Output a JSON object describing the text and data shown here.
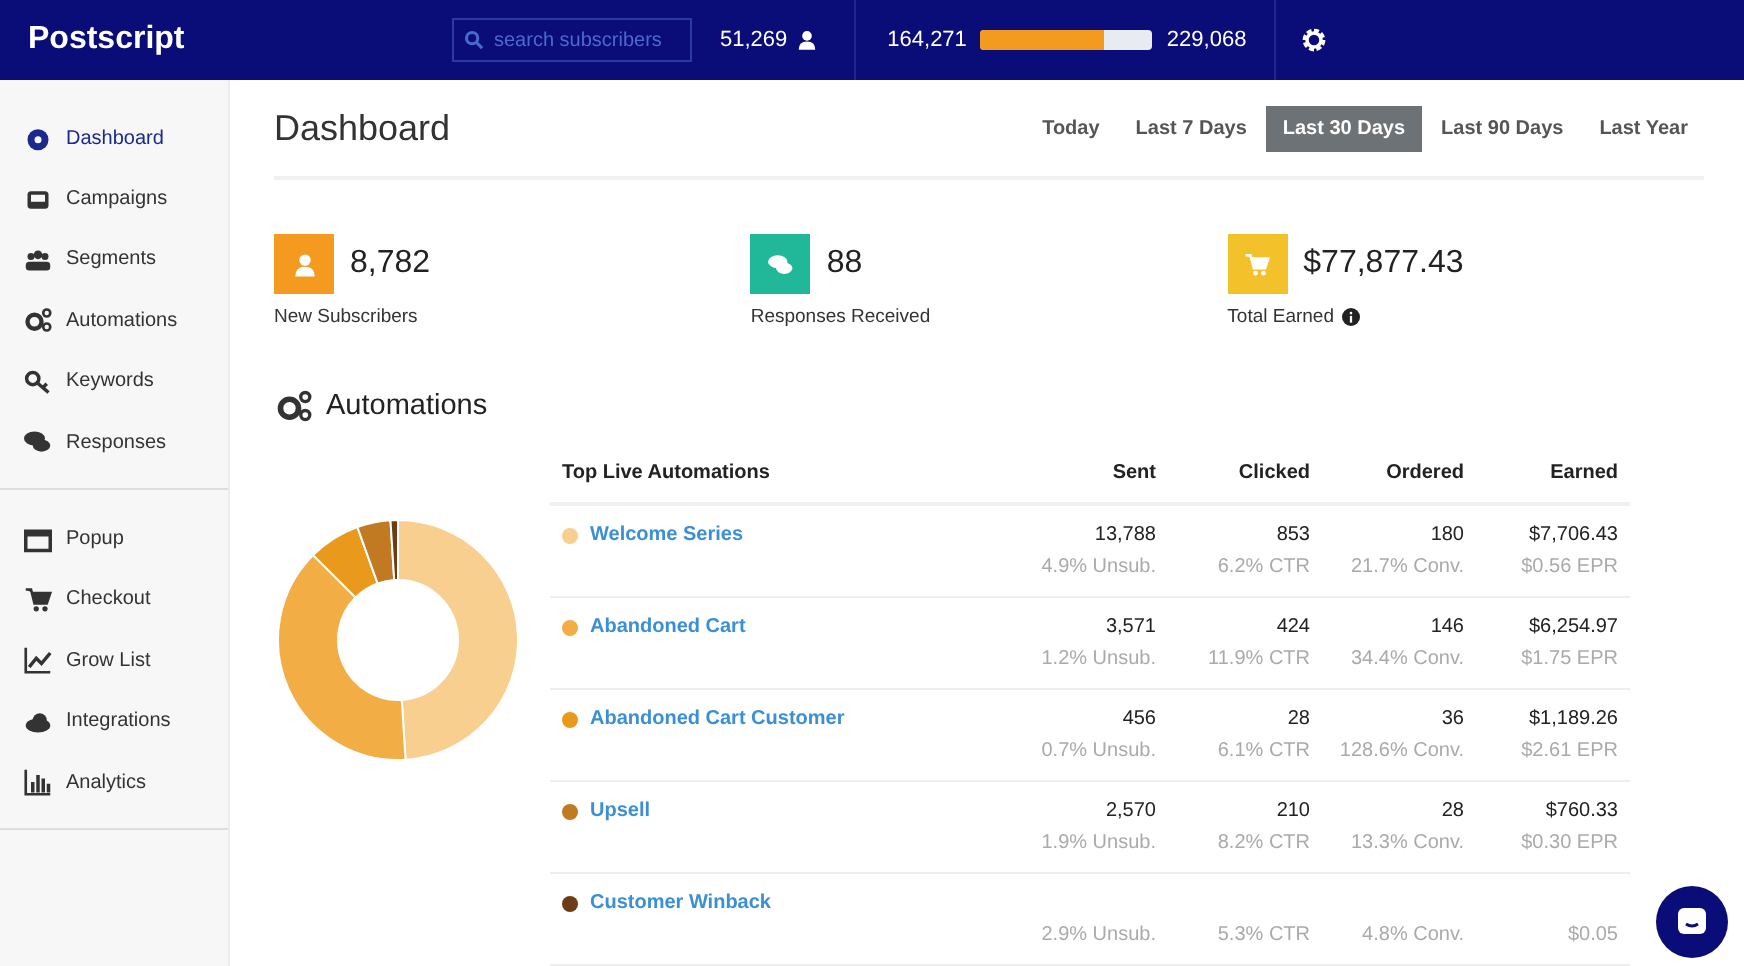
{
  "header": {
    "brand": "Postscript",
    "search": {
      "placeholder": "search subscribers"
    },
    "subscriber_count": "51,269",
    "progress": {
      "current": "164,271",
      "limit": "229,068",
      "level": 0.72
    }
  },
  "sidebar": {
    "groups": [
      [
        {
          "label": "Dashboard",
          "selected": true
        },
        {
          "label": "Campaigns",
          "selected": false
        },
        {
          "label": "Segments",
          "selected": false
        },
        {
          "label": "Automations",
          "selected": false
        },
        {
          "label": "Keywords",
          "selected": false
        },
        {
          "label": "Responses",
          "selected": false
        }
      ],
      [
        {
          "label": "Popup",
          "selected": false
        },
        {
          "label": "Checkout",
          "selected": false
        },
        {
          "label": "Grow List",
          "selected": false
        },
        {
          "label": "Integrations",
          "selected": false
        },
        {
          "label": "Analytics",
          "selected": false
        }
      ]
    ]
  },
  "page_title": "Dashboard",
  "ranges": [
    {
      "label": "Today",
      "selected": false
    },
    {
      "label": "Last 7 Days",
      "selected": false
    },
    {
      "label": "Last 30 Days",
      "selected": true
    },
    {
      "label": "Last 90 Days",
      "selected": false
    },
    {
      "label": "Last Year",
      "selected": false
    }
  ],
  "stats": [
    {
      "value": "8,782",
      "label": "New Subscribers",
      "color": "#f39a1f"
    },
    {
      "value": "88",
      "label": "Responses Received",
      "color": "#21b89a"
    },
    {
      "value": "$77,877.43",
      "label": "Total Earned",
      "color": "#f3c22b",
      "info": true
    }
  ],
  "automations": {
    "title": "Automations",
    "table": {
      "columns": [
        "Top Live Automations",
        "Sent",
        "Clicked",
        "Ordered",
        "Earned"
      ],
      "rows": [
        {
          "color": "#f8cf8e",
          "cells": [
            {
              "value": "Welcome Series"
            },
            {
              "value": "13,788",
              "rate": "4.9% Unsub."
            },
            {
              "value": "853",
              "rate": "6.2% CTR"
            },
            {
              "value": "180",
              "rate": "21.7% Conv."
            },
            {
              "value": "$7,706.43",
              "rate": "$0.56 EPR"
            }
          ]
        },
        {
          "color": "#f2ae45",
          "cells": [
            {
              "value": "Abandoned Cart"
            },
            {
              "value": "3,571",
              "rate": "1.2% Unsub."
            },
            {
              "value": "424",
              "rate": "11.9% CTR"
            },
            {
              "value": "146",
              "rate": "34.4% Conv."
            },
            {
              "value": "$6,254.97",
              "rate": "$1.75 EPR"
            }
          ]
        },
        {
          "color": "#e99a1c",
          "cells": [
            {
              "value": "Abandoned Cart Customer"
            },
            {
              "value": "456",
              "rate": "0.7% Unsub."
            },
            {
              "value": "28",
              "rate": "6.1% CTR"
            },
            {
              "value": "36",
              "rate": "128.6% Conv."
            },
            {
              "value": "$1,189.26",
              "rate": "$2.61 EPR"
            }
          ]
        },
        {
          "color": "#c27a22",
          "cells": [
            {
              "value": "Upsell"
            },
            {
              "value": "2,570",
              "rate": "1.9% Unsub."
            },
            {
              "value": "210",
              "rate": "8.2% CTR"
            },
            {
              "value": "28",
              "rate": "13.3% Conv."
            },
            {
              "value": "$760.33",
              "rate": "$0.30 EPR"
            }
          ]
        },
        {
          "color": "#6b3c16",
          "cells": [
            {
              "value": "Customer Winback"
            },
            {
              "rate": "2.9% Unsub."
            },
            {
              "rate": "5.3% CTR"
            },
            {
              "rate": "4.8% Conv."
            },
            {
              "rate": "$0.05"
            }
          ]
        }
      ]
    }
  }
}
